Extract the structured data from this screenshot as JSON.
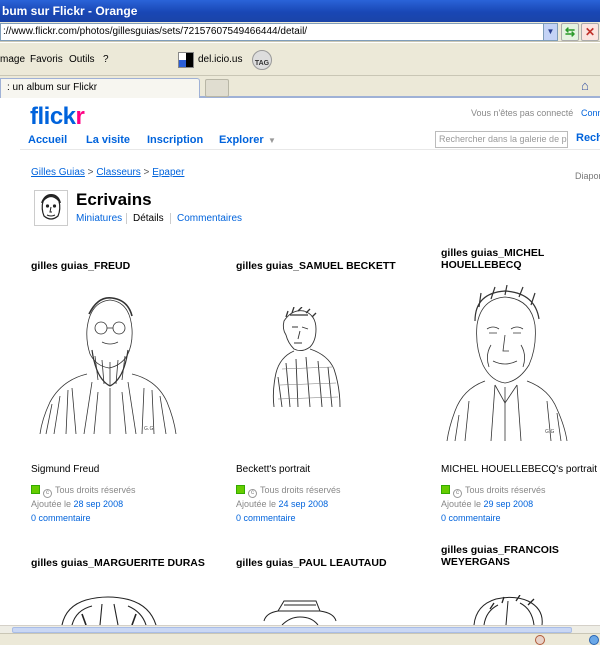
{
  "browser": {
    "title": "bum sur Flickr - Orange",
    "url": "://www.flickr.com/photos/gillesguias/sets/72157607549466444/detail/",
    "menu": [
      "mage",
      "Favoris",
      "Outils",
      "?"
    ],
    "delicious_label": "del.icio.us",
    "tag_icon_label": "TAG",
    "tab_label": ": un album sur Flickr"
  },
  "flickr": {
    "logo_main": "flick",
    "logo_r": "r",
    "signin_note": "Vous n'êtes pas connecté",
    "signin_link": "Conn",
    "nav": [
      "Accueil",
      "La visite",
      "Inscription",
      "Explorer"
    ],
    "search_placeholder": "Rechercher dans la galerie de pho",
    "search_label": "Rech"
  },
  "breadcrumb": {
    "owner": "Gilles Guias",
    "sep1": " > ",
    "collections": "Classeurs",
    "sep2": " > ",
    "collection": "Epaper",
    "slideshow": "Diapor"
  },
  "set": {
    "title": "Ecrivains",
    "tabs": [
      "Miniatures",
      "Détails",
      "Commentaires"
    ]
  },
  "photos": [
    {
      "title": "gilles guias_FREUD",
      "caption": "Sigmund Freud",
      "license": "Tous droits réservés",
      "added_prefix": "Ajoutée le ",
      "date": "28 sep 2008",
      "comments": "0 commentaire"
    },
    {
      "title": "gilles guias_SAMUEL BECKETT",
      "caption": "Beckett's portrait",
      "license": "Tous droits réservés",
      "added_prefix": "Ajoutée le ",
      "date": "24 sep 2008",
      "comments": "0 commentaire"
    },
    {
      "title": "gilles guias_MICHEL HOUELLEBECQ",
      "caption": "MICHEL HOUELLEBECQ's portrait",
      "license": "Tous droits réservés",
      "added_prefix": "Ajoutée le ",
      "date": "29 sep 2008",
      "comments": "0 commentaire"
    },
    {
      "title": "gilles guias_MARGUERITE DURAS"
    },
    {
      "title": "gilles guias_PAUL LEAUTAUD"
    },
    {
      "title": "gilles guias_FRANCOIS WEYERGANS"
    }
  ]
}
